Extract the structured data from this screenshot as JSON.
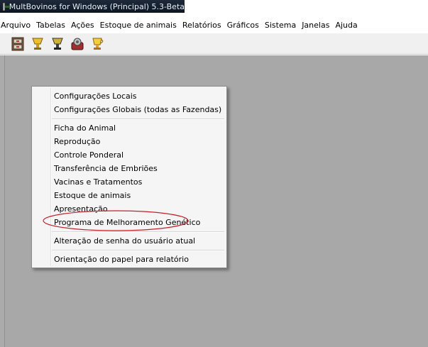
{
  "window": {
    "title": "MultBovinos for Windows (Principal) 5.3-Beta"
  },
  "menubar": {
    "items": [
      "Arquivo",
      "Tabelas",
      "Ações",
      "Estoque de animais",
      "Relatórios",
      "Gráficos",
      "Sistema",
      "Janelas",
      "Ajuda"
    ]
  },
  "toolbar": {
    "icons": [
      "cabinet-icon",
      "trophy-icon",
      "trophy-dark-icon",
      "gear-tool-icon",
      "cup-icon"
    ]
  },
  "context_menu": {
    "items": [
      "Configurações Locais",
      "Configurações Globais (todas as Fazendas)",
      "Ficha do Animal",
      "Reprodução",
      "Controle Ponderal",
      "Transferência de Embriões",
      "Vacinas e Tratamentos",
      "Estoque de animais",
      "Apresentação",
      "Programa de Melhoramento Genético",
      "Alteração de senha do usuário atual",
      "Orientação do papel para relatório"
    ],
    "highlighted_item": "Programa de Melhoramento Genético"
  },
  "colors": {
    "workspace": "#a8a8a8",
    "highlight_ellipse": "#c8202a"
  }
}
